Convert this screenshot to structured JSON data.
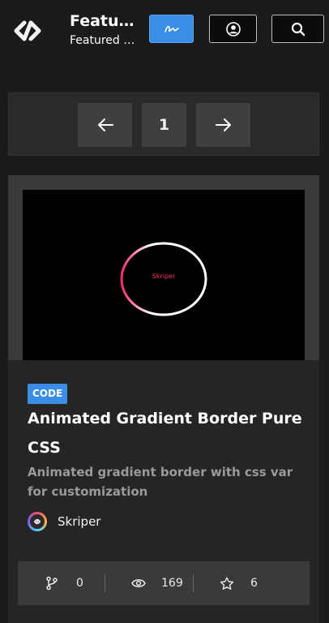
{
  "header": {
    "title": "Featured",
    "subtitle": "Featured Codes",
    "icons": {
      "logo": "link-logo-icon",
      "signature": "signature-icon",
      "user": "user-circle-icon",
      "search": "search-icon"
    }
  },
  "pagination": {
    "prev_icon": "arrow-left-icon",
    "current_page": "1",
    "next_icon": "arrow-right-icon"
  },
  "card": {
    "preview_text": "Skriper",
    "badge": "CODE",
    "title": "Animated Gradient Border Pure CSS",
    "description": "Animated gradient border with css var for customization",
    "author": "Skriper",
    "stats": {
      "forks": "0",
      "views": "169",
      "stars": "6"
    }
  },
  "colors": {
    "background": "#1b1b1b",
    "accent": "#3a8ee6",
    "preview_text": "#ff2a73",
    "muted_text": "#9a9a9a"
  }
}
